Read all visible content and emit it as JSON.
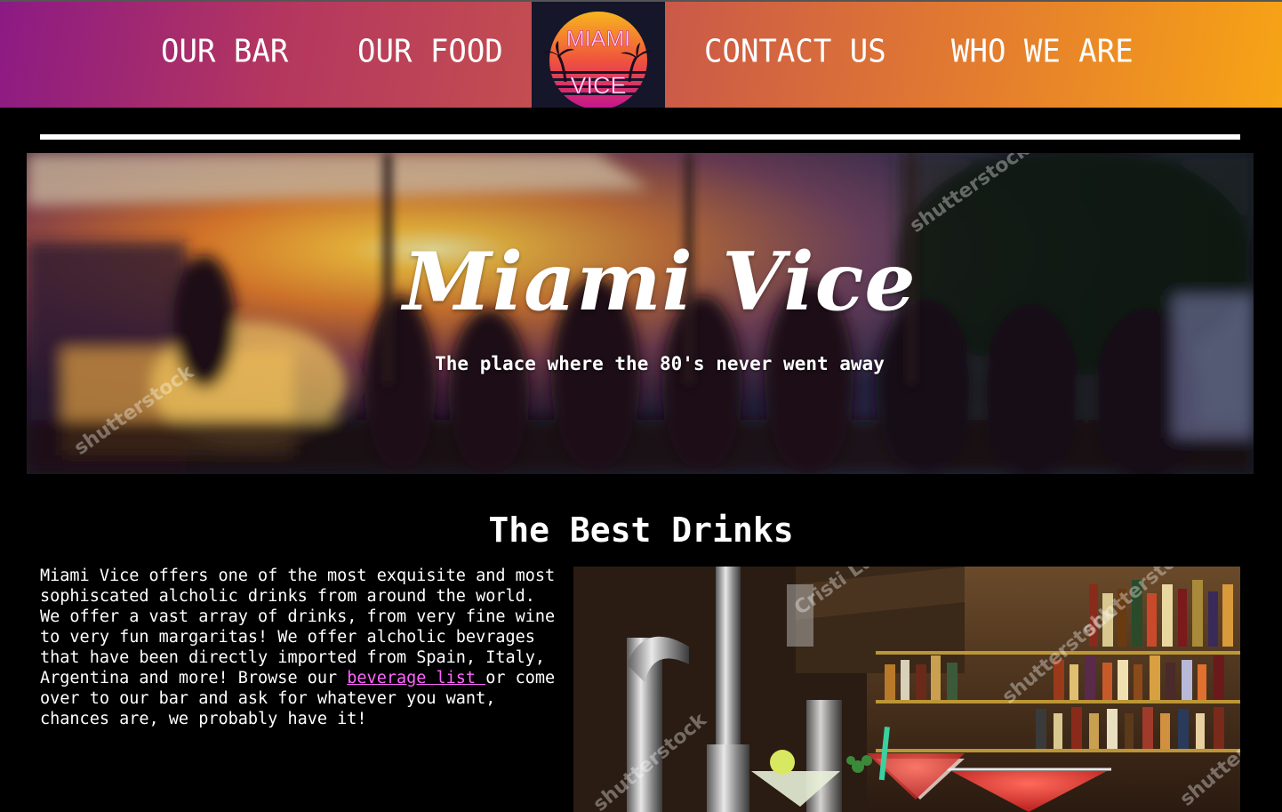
{
  "nav": {
    "items": [
      {
        "label": "OUR BAR"
      },
      {
        "label": "OUR FOOD"
      },
      {
        "label": "CONTACT US"
      },
      {
        "label": "WHO WE ARE"
      }
    ],
    "logo": {
      "line1": "MIAMI",
      "line2": "VICE"
    }
  },
  "hero": {
    "title": "Miami Vice",
    "subtitle": "The place where the 80's never went away"
  },
  "drinks": {
    "title": "The Best Drinks",
    "text_before": "Miami Vice offers one of the most exquisite and most sophiscated alcholic drinks from around the world. We offer a vast array of drinks, from very fine wine to very fun margaritas! We offer alcholic bevrages that have been directly imported from Spain, Italy, Argentina and more! Browse our ",
    "link_text": "beverage list ",
    "text_after": "or come over to our bar and ask for whatever you want, chances are, we probably have it!"
  },
  "colors": {
    "nav_gradient_start": "#8c1a84",
    "nav_gradient_end": "#f7a415",
    "link": "#ff66ff",
    "background": "#000000"
  }
}
